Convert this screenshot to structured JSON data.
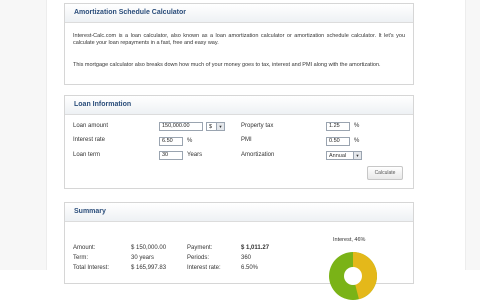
{
  "intro": {
    "title": "Amortization Schedule Calculator",
    "paragraph1": "Interest-Calc.com is a loan calculator, also known as a loan amortization calculator or amortization schedule calculator. It let's you calculate your loan repayments in a fast, free and easy way.",
    "paragraph2": "This mortgage calculator also breaks down how much of your money goes to tax, interest and PMI along with the amortization."
  },
  "loan": {
    "title": "Loan Information",
    "amount_label": "Loan amount",
    "amount_value": "150,000.00",
    "currency_value": "$",
    "rate_label": "Interest rate",
    "rate_value": "6.50",
    "rate_unit": "%",
    "term_label": "Loan term",
    "term_value": "30",
    "term_unit": "Years",
    "tax_label": "Property tax",
    "tax_value": "1.25",
    "tax_unit": "%",
    "pmi_label": "PMI",
    "pmi_value": "0.50",
    "pmi_unit": "%",
    "amort_label": "Amortization",
    "amort_value": "Annual",
    "calculate_label": "Calculate"
  },
  "summary": {
    "title": "Summary",
    "amount_label": "Amount:",
    "amount_value": "$ 150,000.00",
    "term_label": "Term:",
    "term_value": "30 years",
    "total_interest_label": "Total Interest:",
    "total_interest_value": "$ 165,997.83",
    "payment_label": "Payment:",
    "payment_value": "$ 1,011.27",
    "periods_label": "Periods:",
    "periods_value": "360",
    "rate_label": "Interest rate:",
    "rate_value": "6.50%",
    "pie_label": "Interest, 46%",
    "interest_share": 0.46,
    "colors": {
      "interest": "#e4b81a",
      "principal": "#7ab317"
    }
  }
}
